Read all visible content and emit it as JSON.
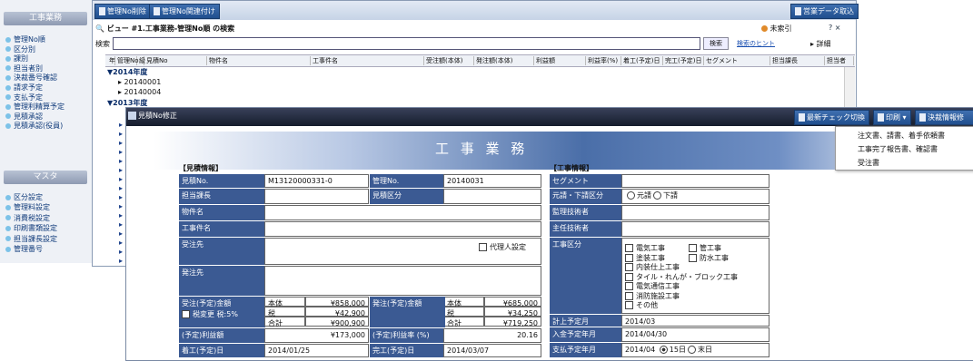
{
  "sidebar": {
    "header1": "工事業務",
    "items1": [
      "管理No順",
      "区分別",
      "課別",
      "担当者別",
      "決裁番号確認",
      "請求予定",
      "支払予定",
      "管理利精算予定",
      "見積承認",
      "見積承認(役員)"
    ],
    "header2": "マスタ",
    "items2": [
      "区分設定",
      "管理料設定",
      "消費税設定",
      "印刷書類設定",
      "担当課長設定",
      "管理番号"
    ]
  },
  "toolbar": {
    "btn1": "管理No削除",
    "btn2": "管理No関連付け",
    "btn_right": "営業データ取込"
  },
  "view": {
    "title": "ビュー #1.工事業務-管理No順 の検索",
    "status": "未索引",
    "help": "? ×",
    "search_label": "検索",
    "search_button": "検索",
    "search_hint": "検索のヒント",
    "detail_button": "▸ 詳細"
  },
  "columns": [
    "年",
    "管理No",
    "級",
    "見積No",
    "物件名",
    "工事件名",
    "受注額(本体)",
    "発注額(本体)",
    "利益額",
    "利益率(%)",
    "着工(予定)日",
    "完工(予定)日",
    "セグメント",
    "担当課長",
    "担当者"
  ],
  "tree": {
    "y2014": "▼2014年度",
    "rows2014": [
      "▸ 20140001",
      "▸ 20140004"
    ],
    "y2013": "▼2013年度"
  },
  "dialog": {
    "title": "見積No修正",
    "btn_check": "最新チェック切換",
    "btn_print": "印刷",
    "btn_decision": "決裁情報修",
    "menu": [
      "注文書、請書、着手依頼書",
      "工事完了報告書、確認書",
      "受注書"
    ]
  },
  "form": {
    "header": "工 事 業 務",
    "left_section": "【見積情報】",
    "right_section": "【工事情報】",
    "l_mitsumori_no": "見積No.",
    "v_mitsumori_no": "M13120000331-0",
    "l_kanri_no": "管理No.",
    "v_kanri_no": "20140031",
    "l_tanto_kacho": "担当課長",
    "l_mitsumori_kubun": "見積区分",
    "l_bukken": "物件名",
    "l_koji_kenmei": "工事件名",
    "l_juchusaki": "受注先",
    "l_dairinin": "代理人設定",
    "l_hachusaki": "発注先",
    "l_juchu_kingaku": "受注(予定)金額",
    "l_zeihenko": "税変更 税:5%",
    "juchu_rows": [
      [
        "本体",
        "¥858,000"
      ],
      [
        "税",
        "¥42,900"
      ],
      [
        "合計",
        "¥900,900"
      ]
    ],
    "l_hachu_kingaku": "発注(予定)金額",
    "hachu_rows": [
      [
        "本体",
        "¥685,000"
      ],
      [
        "税",
        "¥34,250"
      ],
      [
        "合計",
        "¥719,250"
      ]
    ],
    "l_rieki_gaku": "(予定)利益額",
    "v_rieki_gaku": "¥173,000",
    "l_rieki_ritsu": "(予定)利益率 (%)",
    "v_rieki_ritsu": "20.16",
    "l_chakko": "着工(予定)日",
    "v_chakko": "2014/01/25",
    "l_kanko": "完工(予定)日",
    "v_kanko": "2014/03/07",
    "l_segment": "セグメント",
    "l_motouke": "元請・下請区分",
    "motouke_opt1": "元請",
    "motouke_opt2": "下請",
    "l_kanri_gijutsu": "監理技術者",
    "l_shunin_gijutsu": "主任技術者",
    "l_koji_kubun": "工事区分",
    "koji_kubun": [
      "電気工事",
      "管工事",
      "塗装工事",
      "防水工事",
      "内装仕上工事",
      "タイル・れんが・ブロック工事",
      "電気通信工事",
      "消防施設工事",
      "その他"
    ],
    "l_keijo": "計上予定月",
    "v_keijo": "2014/03",
    "l_nyukin": "入金予定年月",
    "v_nyukin": "2014/04/30",
    "l_shiharai": "支払予定年月",
    "v_shiharai": "2014/04",
    "shiharai_opt1": "15日",
    "shiharai_opt2": "末日"
  },
  "colors": {
    "accent": "#3b5a93",
    "toolbar": "#204f8e",
    "dialog_bar": "#1c2436"
  }
}
